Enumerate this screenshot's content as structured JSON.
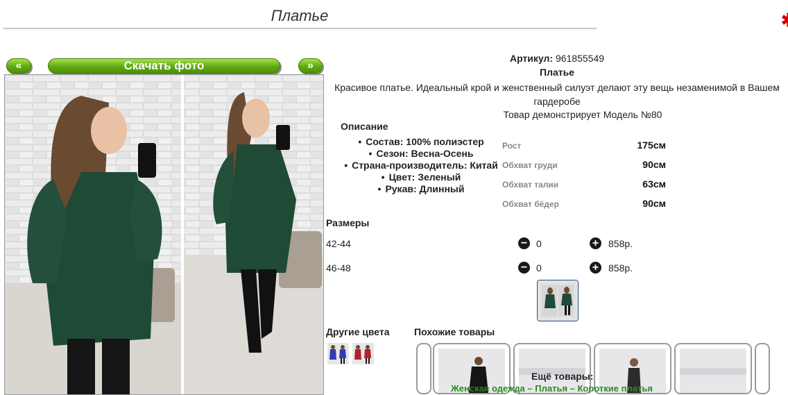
{
  "page": {
    "title": "Платье"
  },
  "nav": {
    "prev_label": "«",
    "next_label": "»",
    "download_label": "Скачать фото"
  },
  "product": {
    "article_label": "Артикул:",
    "article_value": "961855549",
    "name": "Платье",
    "description": "Красивое платье. Идеальный крой и женственный силуэт делают эту вещь незаменимой в Вашем гардеробе",
    "model_text": "Товар демонстрирует Модель №80"
  },
  "description_section": {
    "heading": "Описание",
    "attributes": [
      "Состав: 100% полиэстер",
      "Сезон: Весна-Осень",
      "Страна-производитель: Китай",
      "Цвет: Зеленый",
      "Рукав: Длинный"
    ]
  },
  "measurements": [
    {
      "label": "Рост",
      "value": "175см"
    },
    {
      "label": "Обхват груди",
      "value": "90см"
    },
    {
      "label": "Обхват талии",
      "value": "63см"
    },
    {
      "label": "Обхват бёдер",
      "value": "90см"
    }
  ],
  "sizes": {
    "heading": "Размеры",
    "rows": [
      {
        "size": "42-44",
        "qty": "0",
        "price": "858р."
      },
      {
        "size": "46-48",
        "qty": "0",
        "price": "858р."
      }
    ]
  },
  "icons": {
    "minus": "minus-circle-icon",
    "plus": "plus-circle-icon"
  },
  "colors": {
    "button_green": "#5fa811",
    "dress_green": "#1f4a35",
    "link_green": "#2d8a1f"
  },
  "other_colors": {
    "heading": "Другие цвета"
  },
  "similar": {
    "heading": "Похожие товары"
  },
  "more": {
    "heading": "Ещё товары:",
    "links": [
      "Женская одежда",
      "Платья",
      "Короткие платья"
    ]
  }
}
